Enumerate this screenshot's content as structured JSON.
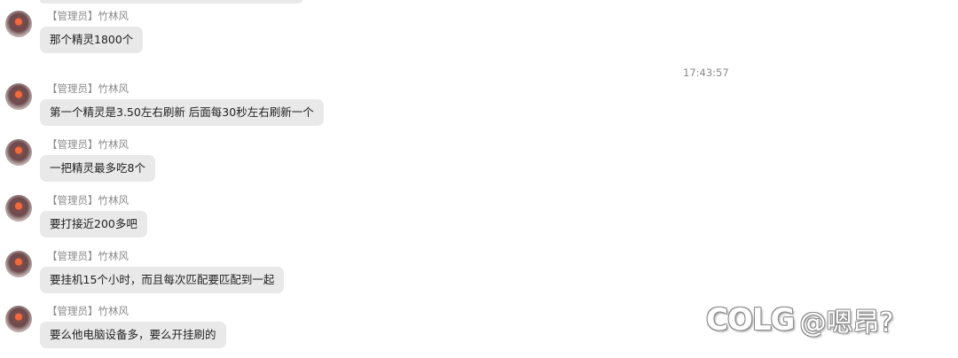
{
  "chat": {
    "timestamp": "17:43:57",
    "messages": [
      {
        "sender": "【管理员】竹林风",
        "text": "那个精灵1800个"
      },
      {
        "sender": "【管理员】竹林风",
        "text": "第一个精灵是3.50左右刷新 后面每30秒左右刷新一个"
      },
      {
        "sender": "【管理员】竹林风",
        "text": "一把精灵最多吃8个"
      },
      {
        "sender": "【管理员】竹林风",
        "text": "要打接近200多吧"
      },
      {
        "sender": "【管理员】竹林风",
        "text": "要挂机15个小时，而且每次匹配要匹配到一起"
      },
      {
        "sender": "【管理员】竹林风",
        "text": "要么他电脑设备多，要么开挂刷的"
      }
    ]
  },
  "watermark": {
    "logo": "COLG",
    "handle": "@嗯昂?"
  }
}
